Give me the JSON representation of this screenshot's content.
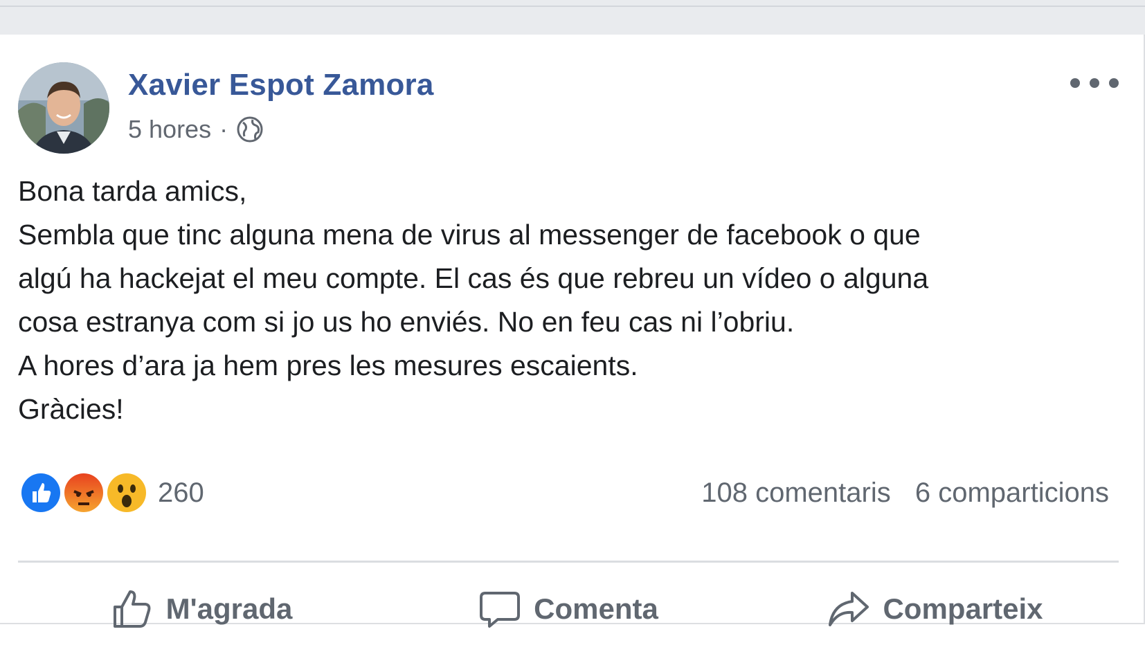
{
  "post": {
    "author_name": "Xavier Espot Zamora",
    "timestamp": "5 hores",
    "separator": "·",
    "privacy_icon": "globe-icon",
    "more_icon": "more-options-icon",
    "text_lines": [
      "Bona tarda amics,",
      "Sembla que tinc alguna mena de virus al messenger de facebook o que",
      "algú ha hackejat el meu compte. El cas és que rebreu un vídeo o alguna",
      "cosa estranya com si jo us ho enviés. No en feu cas ni l’obriu.",
      "A hores d’ara ja hem pres les mesures escaients.",
      "Gràcies!"
    ]
  },
  "engagement": {
    "reactions": [
      "like-reaction-icon",
      "angry-reaction-icon",
      "wow-reaction-icon"
    ],
    "reaction_count": "260",
    "comments": "108 comentaris",
    "shares": "6 comparticions"
  },
  "actions": {
    "like_label": "M'agrada",
    "comment_label": "Comenta",
    "share_label": "Comparteix"
  },
  "colors": {
    "author": "#385898",
    "meta": "#616770",
    "text": "#1c1e21",
    "like": "#1877f2",
    "angry": "#f0642d",
    "wow": "#f7b928"
  }
}
